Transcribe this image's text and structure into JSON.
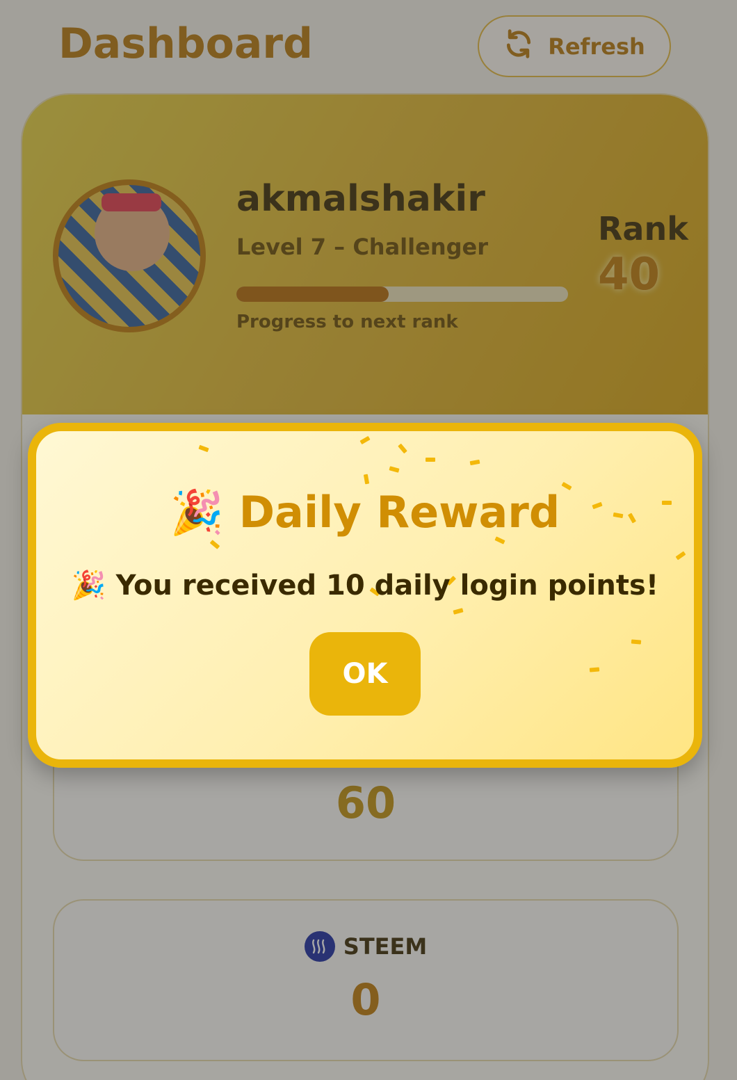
{
  "header": {
    "title": "Dashboard",
    "refresh_label": "Refresh",
    "refresh_icon": "refresh-icon"
  },
  "profile": {
    "username": "akmalshakir",
    "level": "Level 7 – Challenger",
    "progress_label": "Progress to next rank",
    "progress_fraction": 0.46,
    "rank_label": "Rank",
    "rank_value": "40"
  },
  "stats": {
    "points_value": "60",
    "steem_label": "STEEM",
    "steem_value": "0",
    "steem_icon": "steem-logo-icon"
  },
  "modal": {
    "title": "Daily Reward",
    "title_emoji": "🎉",
    "message": "You received 10 daily login points!",
    "message_emoji": "🎉",
    "ok_label": "OK"
  },
  "colors": {
    "accent": "#eab50b",
    "title_gold": "#b9780a",
    "progress_fill": "#b76a05",
    "steem_blue": "#1a2aa0"
  }
}
